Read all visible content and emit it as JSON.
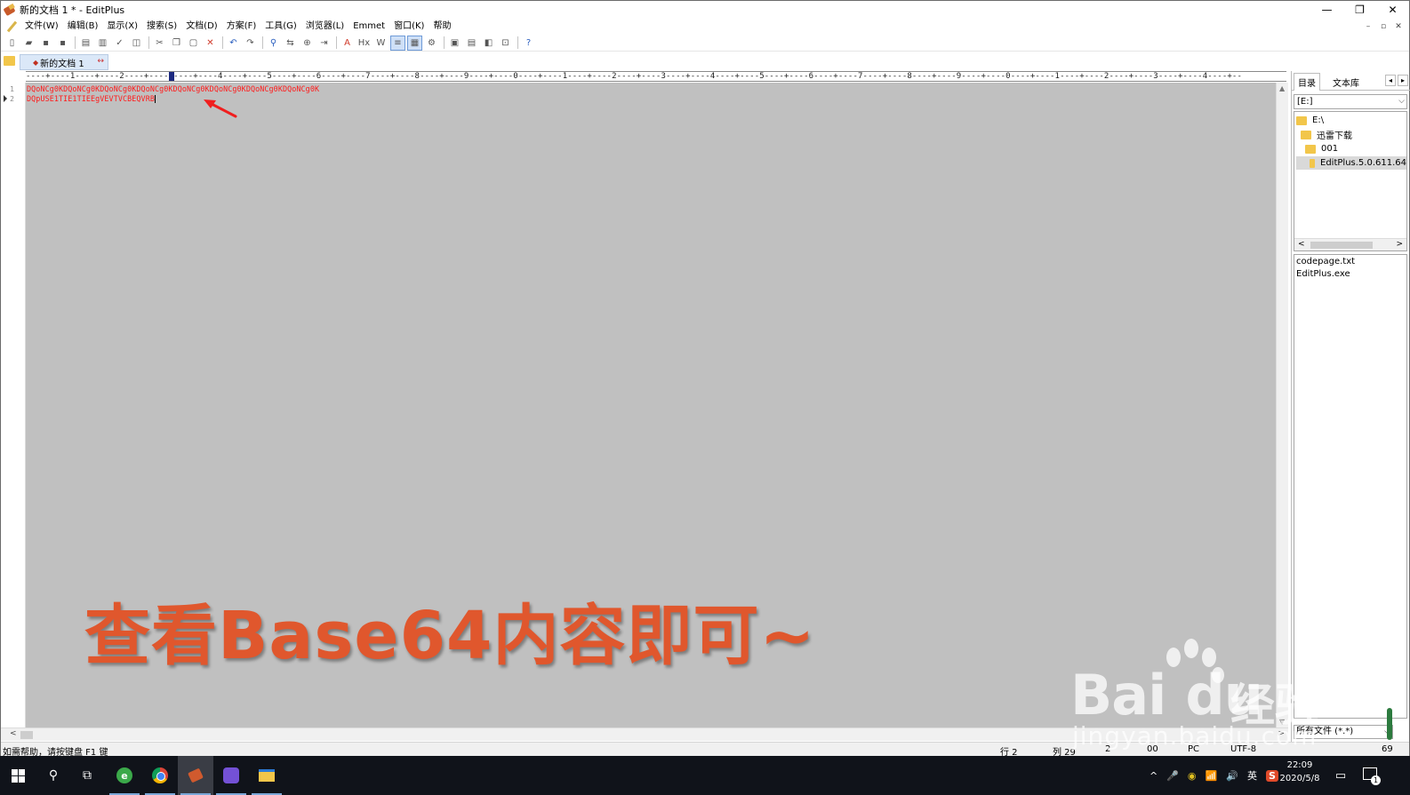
{
  "window": {
    "title": "新的文档 1 * - EditPlus",
    "controls": [
      "—",
      "❐",
      "✕"
    ]
  },
  "menu": {
    "items": [
      "文件(W)",
      "编辑(B)",
      "显示(X)",
      "搜索(S)",
      "文档(D)",
      "方案(F)",
      "工具(G)",
      "浏览器(L)",
      "Emmet",
      "窗口(K)",
      "帮助"
    ],
    "mdi_controls": [
      "–",
      "▫",
      "✕"
    ]
  },
  "toolbar": {
    "buttons": [
      {
        "name": "new-file-icon",
        "glyph": "▯"
      },
      {
        "name": "open-file-icon",
        "glyph": "▰"
      },
      {
        "name": "save-icon",
        "glyph": "▪"
      },
      {
        "name": "save-all-icon",
        "glyph": "▪"
      },
      {
        "sep": true
      },
      {
        "name": "print-preview-icon",
        "glyph": "▤"
      },
      {
        "name": "print-icon",
        "glyph": "▥"
      },
      {
        "name": "spellcheck-icon",
        "glyph": "✓"
      },
      {
        "name": "browser-preview-icon",
        "glyph": "◫"
      },
      {
        "sep": true
      },
      {
        "name": "cut-icon",
        "glyph": "✂"
      },
      {
        "name": "copy-icon",
        "glyph": "❐"
      },
      {
        "name": "paste-icon",
        "glyph": "▢"
      },
      {
        "name": "delete-icon",
        "glyph": "✕",
        "color": "red"
      },
      {
        "sep": true
      },
      {
        "name": "undo-icon",
        "glyph": "↶",
        "color": "blue"
      },
      {
        "name": "redo-icon",
        "glyph": "↷"
      },
      {
        "sep": true
      },
      {
        "name": "find-icon",
        "glyph": "⚲",
        "color": "blue"
      },
      {
        "name": "replace-icon",
        "glyph": "⇆"
      },
      {
        "name": "find-in-files-icon",
        "glyph": "⊕"
      },
      {
        "name": "goto-line-icon",
        "glyph": "⇥"
      },
      {
        "sep": true
      },
      {
        "name": "font-icon",
        "glyph": "A",
        "color": "red"
      },
      {
        "name": "hex-icon",
        "glyph": "Hx"
      },
      {
        "name": "word-wrap-icon",
        "glyph": "W"
      },
      {
        "name": "line-number-icon",
        "glyph": "≡",
        "active": true
      },
      {
        "name": "column-select-icon",
        "glyph": "▦",
        "active": true
      },
      {
        "name": "settings-icon",
        "glyph": "⚙"
      },
      {
        "sep": true
      },
      {
        "name": "cliptext-icon",
        "glyph": "▣"
      },
      {
        "name": "directory-icon",
        "glyph": "▤"
      },
      {
        "name": "output-window-icon",
        "glyph": "◧"
      },
      {
        "name": "fullscreen-icon",
        "glyph": "⊡"
      },
      {
        "sep": true
      },
      {
        "name": "help-icon",
        "glyph": "?",
        "color": "blue"
      }
    ]
  },
  "tabs": [
    {
      "label": "新的文档 1",
      "modified_mark": "◆",
      "close": "↔"
    }
  ],
  "ruler": {
    "text": "----+----1----+----2----+----3----+----4----+----5----+----6----+----7----+----8----+----9----+----0----+----1----+----2----+----3----+----4----+----5----+----6----+----7----+----8----+----9----+----0----+----1----+----2----+----3----+----4----+--"
  },
  "editor": {
    "line_numbers": [
      "1",
      "2"
    ],
    "lines": [
      "DQoNCg0KDQoNCg0KDQoNCg0KDQoNCg0KDQoNCg0KDQoNCg0KDQoNCg0KDQoNCg0K",
      "DQpUSE1TIE1TIEEgVEVTVCBEQVRB"
    ],
    "caption": "查看Base64内容即可~"
  },
  "right_panel": {
    "tabs": [
      "目录",
      "文本库"
    ],
    "drive": "[E:]",
    "tree": [
      {
        "label": "E:\\",
        "indent": 0
      },
      {
        "label": "迅雷下载",
        "indent": 1
      },
      {
        "label": "001",
        "indent": 2
      },
      {
        "label": "EditPlus.5.0.611.64",
        "indent": 3,
        "selected": true
      }
    ],
    "files": [
      "codepage.txt",
      "EditPlus.exe"
    ],
    "filter": "所有文件 (*.*)"
  },
  "statusbar": {
    "help": "如需帮助，请按键盘 F1 键",
    "line": "行 2",
    "col": "列 29",
    "lines_total": "2",
    "code": "00",
    "format": "PC",
    "encoding": "UTF-8",
    "extra": "69"
  },
  "taskbar": {
    "tray_items": [
      "^",
      "🎤",
      "◉",
      "📶",
      "🔊",
      "英",
      "S"
    ],
    "time": "22:09",
    "date": "2020/5/8",
    "notification_count": "1"
  },
  "watermark": {
    "brand": "Bai",
    "brand2": "du",
    "cn": "经验",
    "url": "jingyan.baidu.com"
  }
}
